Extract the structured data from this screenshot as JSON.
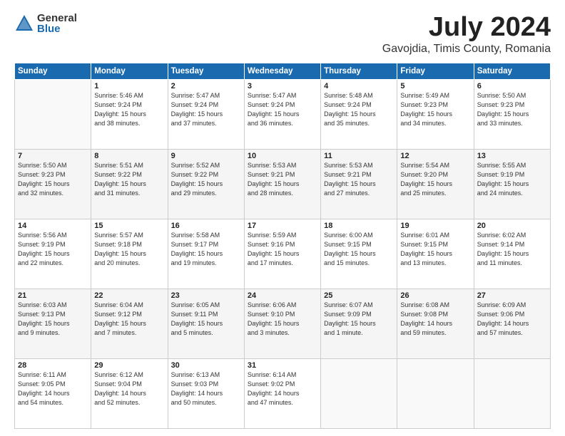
{
  "header": {
    "logo_general": "General",
    "logo_blue": "Blue",
    "month_title": "July 2024",
    "location": "Gavojdia, Timis County, Romania"
  },
  "days_of_week": [
    "Sunday",
    "Monday",
    "Tuesday",
    "Wednesday",
    "Thursday",
    "Friday",
    "Saturday"
  ],
  "weeks": [
    [
      {
        "day": "",
        "info": ""
      },
      {
        "day": "1",
        "info": "Sunrise: 5:46 AM\nSunset: 9:24 PM\nDaylight: 15 hours\nand 38 minutes."
      },
      {
        "day": "2",
        "info": "Sunrise: 5:47 AM\nSunset: 9:24 PM\nDaylight: 15 hours\nand 37 minutes."
      },
      {
        "day": "3",
        "info": "Sunrise: 5:47 AM\nSunset: 9:24 PM\nDaylight: 15 hours\nand 36 minutes."
      },
      {
        "day": "4",
        "info": "Sunrise: 5:48 AM\nSunset: 9:24 PM\nDaylight: 15 hours\nand 35 minutes."
      },
      {
        "day": "5",
        "info": "Sunrise: 5:49 AM\nSunset: 9:23 PM\nDaylight: 15 hours\nand 34 minutes."
      },
      {
        "day": "6",
        "info": "Sunrise: 5:50 AM\nSunset: 9:23 PM\nDaylight: 15 hours\nand 33 minutes."
      }
    ],
    [
      {
        "day": "7",
        "info": "Sunrise: 5:50 AM\nSunset: 9:23 PM\nDaylight: 15 hours\nand 32 minutes."
      },
      {
        "day": "8",
        "info": "Sunrise: 5:51 AM\nSunset: 9:22 PM\nDaylight: 15 hours\nand 31 minutes."
      },
      {
        "day": "9",
        "info": "Sunrise: 5:52 AM\nSunset: 9:22 PM\nDaylight: 15 hours\nand 29 minutes."
      },
      {
        "day": "10",
        "info": "Sunrise: 5:53 AM\nSunset: 9:21 PM\nDaylight: 15 hours\nand 28 minutes."
      },
      {
        "day": "11",
        "info": "Sunrise: 5:53 AM\nSunset: 9:21 PM\nDaylight: 15 hours\nand 27 minutes."
      },
      {
        "day": "12",
        "info": "Sunrise: 5:54 AM\nSunset: 9:20 PM\nDaylight: 15 hours\nand 25 minutes."
      },
      {
        "day": "13",
        "info": "Sunrise: 5:55 AM\nSunset: 9:19 PM\nDaylight: 15 hours\nand 24 minutes."
      }
    ],
    [
      {
        "day": "14",
        "info": "Sunrise: 5:56 AM\nSunset: 9:19 PM\nDaylight: 15 hours\nand 22 minutes."
      },
      {
        "day": "15",
        "info": "Sunrise: 5:57 AM\nSunset: 9:18 PM\nDaylight: 15 hours\nand 20 minutes."
      },
      {
        "day": "16",
        "info": "Sunrise: 5:58 AM\nSunset: 9:17 PM\nDaylight: 15 hours\nand 19 minutes."
      },
      {
        "day": "17",
        "info": "Sunrise: 5:59 AM\nSunset: 9:16 PM\nDaylight: 15 hours\nand 17 minutes."
      },
      {
        "day": "18",
        "info": "Sunrise: 6:00 AM\nSunset: 9:15 PM\nDaylight: 15 hours\nand 15 minutes."
      },
      {
        "day": "19",
        "info": "Sunrise: 6:01 AM\nSunset: 9:15 PM\nDaylight: 15 hours\nand 13 minutes."
      },
      {
        "day": "20",
        "info": "Sunrise: 6:02 AM\nSunset: 9:14 PM\nDaylight: 15 hours\nand 11 minutes."
      }
    ],
    [
      {
        "day": "21",
        "info": "Sunrise: 6:03 AM\nSunset: 9:13 PM\nDaylight: 15 hours\nand 9 minutes."
      },
      {
        "day": "22",
        "info": "Sunrise: 6:04 AM\nSunset: 9:12 PM\nDaylight: 15 hours\nand 7 minutes."
      },
      {
        "day": "23",
        "info": "Sunrise: 6:05 AM\nSunset: 9:11 PM\nDaylight: 15 hours\nand 5 minutes."
      },
      {
        "day": "24",
        "info": "Sunrise: 6:06 AM\nSunset: 9:10 PM\nDaylight: 15 hours\nand 3 minutes."
      },
      {
        "day": "25",
        "info": "Sunrise: 6:07 AM\nSunset: 9:09 PM\nDaylight: 15 hours\nand 1 minute."
      },
      {
        "day": "26",
        "info": "Sunrise: 6:08 AM\nSunset: 9:08 PM\nDaylight: 14 hours\nand 59 minutes."
      },
      {
        "day": "27",
        "info": "Sunrise: 6:09 AM\nSunset: 9:06 PM\nDaylight: 14 hours\nand 57 minutes."
      }
    ],
    [
      {
        "day": "28",
        "info": "Sunrise: 6:11 AM\nSunset: 9:05 PM\nDaylight: 14 hours\nand 54 minutes."
      },
      {
        "day": "29",
        "info": "Sunrise: 6:12 AM\nSunset: 9:04 PM\nDaylight: 14 hours\nand 52 minutes."
      },
      {
        "day": "30",
        "info": "Sunrise: 6:13 AM\nSunset: 9:03 PM\nDaylight: 14 hours\nand 50 minutes."
      },
      {
        "day": "31",
        "info": "Sunrise: 6:14 AM\nSunset: 9:02 PM\nDaylight: 14 hours\nand 47 minutes."
      },
      {
        "day": "",
        "info": ""
      },
      {
        "day": "",
        "info": ""
      },
      {
        "day": "",
        "info": ""
      }
    ]
  ]
}
